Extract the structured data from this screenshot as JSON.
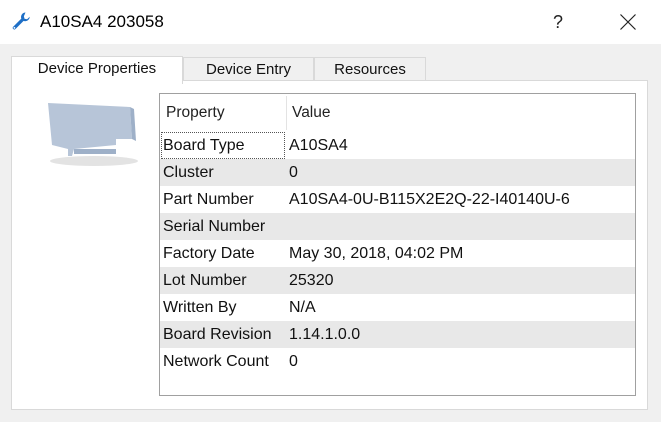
{
  "window": {
    "title": "A10SA4 203058",
    "help_label": "?",
    "title_icon": "wrench-icon",
    "close_icon": "close-icon"
  },
  "tabs": [
    {
      "label": "Device Properties",
      "active": true
    },
    {
      "label": "Device Entry",
      "active": false
    },
    {
      "label": "Resources",
      "active": false
    }
  ],
  "grid": {
    "columns": [
      "Property",
      "Value"
    ],
    "rows": [
      {
        "property": "Board Type",
        "value": "A10SA4"
      },
      {
        "property": "Cluster",
        "value": "0"
      },
      {
        "property": "Part Number",
        "value": "A10SA4-0U-B115X2E2Q-22-I40140U-6"
      },
      {
        "property": "Serial Number",
        "value": ""
      },
      {
        "property": "Factory Date",
        "value": "May 30, 2018, 04:02 PM"
      },
      {
        "property": "Lot Number",
        "value": "25320"
      },
      {
        "property": "Written By",
        "value": "N/A"
      },
      {
        "property": "Board Revision",
        "value": "1.14.1.0.0"
      },
      {
        "property": "Network Count",
        "value": "0"
      }
    ]
  }
}
